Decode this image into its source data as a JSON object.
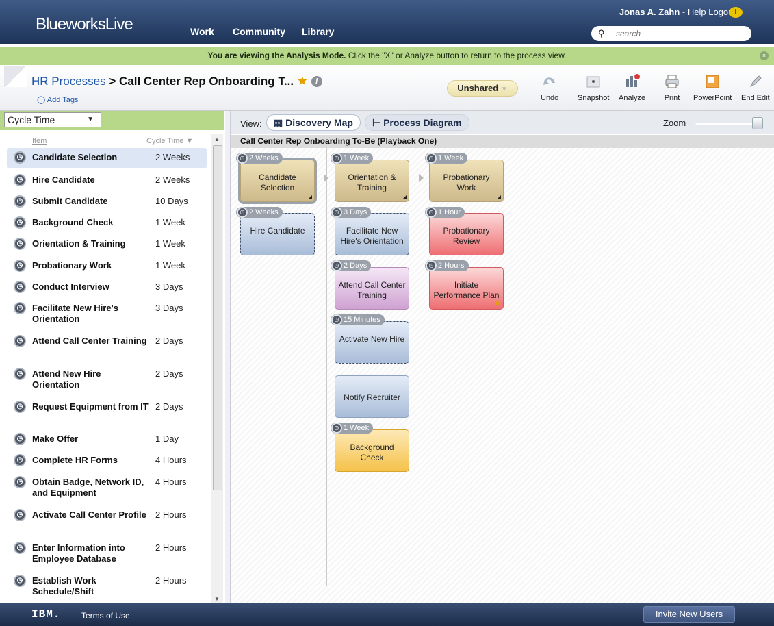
{
  "header": {
    "logo_bold": "Blueworks",
    "logo_thin": "Live",
    "nav": [
      "Work",
      "Community",
      "Library"
    ],
    "user": "Jonas A. Zahn",
    "sep": "-",
    "help": "Help",
    "logout": "Logout",
    "search_placeholder": "search"
  },
  "banner": {
    "bold": "You are viewing the Analysis Mode.",
    "rest": " Click the \"X\" or Analyze button to return to the process view."
  },
  "titlebar": {
    "crumb_link": "HR Processes",
    "crumb_sep": " > ",
    "crumb_current": "Call Center Rep Onboarding T...",
    "add_tags": "Add Tags",
    "share": "Unshared",
    "tools": [
      "Undo",
      "Snapshot",
      "Analyze",
      "Print",
      "PowerPoint",
      "End Edit"
    ]
  },
  "leftpanel": {
    "metric": "Cycle Time",
    "col_item": "Item",
    "col_time": "Cycle Time",
    "rows": [
      {
        "name": "Candidate Selection",
        "time": "2 Weeks"
      },
      {
        "name": "Hire Candidate",
        "time": "2 Weeks"
      },
      {
        "name": "Submit Candidate",
        "time": "10 Days"
      },
      {
        "name": "Background Check",
        "time": "1 Week"
      },
      {
        "name": "Orientation & Training",
        "time": "1 Week"
      },
      {
        "name": "Probationary Work",
        "time": "1 Week"
      },
      {
        "name": "Conduct Interview",
        "time": "3 Days"
      },
      {
        "name": "Facilitate New Hire's Orientation",
        "time": "3 Days"
      },
      {
        "name": "Attend Call Center Training",
        "time": "2 Days"
      },
      {
        "name": "Attend New Hire Orientation",
        "time": "2 Days"
      },
      {
        "name": "Request Equipment from IT",
        "time": "2 Days"
      },
      {
        "name": "Make Offer",
        "time": "1 Day"
      },
      {
        "name": "Complete HR Forms",
        "time": "4 Hours"
      },
      {
        "name": "Obtain Badge, Network ID, and Equipment",
        "time": "4 Hours"
      },
      {
        "name": "Activate Call Center Profile",
        "time": "2 Hours"
      },
      {
        "name": "Enter Information into Employee Database",
        "time": "2 Hours"
      },
      {
        "name": "Establish Work Schedule/Shift",
        "time": "2 Hours"
      }
    ]
  },
  "view": {
    "label": "View:",
    "discovery": "Discovery Map",
    "process": "Process Diagram",
    "zoom": "Zoom"
  },
  "canvas": {
    "title": "Call Center Rep Onboarding To-Be (Playback One)",
    "cards": {
      "c1": {
        "label": "Candidate Selection",
        "badge": "2 Weeks"
      },
      "c2": {
        "label": "Hire Candidate",
        "badge": "2 Weeks"
      },
      "c3": {
        "label": "Orientation & Training",
        "badge": "1 Week"
      },
      "c4": {
        "label": "Facilitate New Hire's Orientation",
        "badge": "3 Days"
      },
      "c5": {
        "label": "Attend Call Center Training",
        "badge": "2 Days"
      },
      "c6": {
        "label": "Activate New Hire",
        "badge": "15 Minutes"
      },
      "c7": {
        "label": "Notify Recruiter",
        "badge": ""
      },
      "c8": {
        "label": "Background Check",
        "badge": "1 Week"
      },
      "c9": {
        "label": "Probationary Work",
        "badge": "1 Week"
      },
      "c10": {
        "label": "Probationary Review",
        "badge": "1 Hour"
      },
      "c11": {
        "label": "Initiate Performance Plan",
        "badge": "2 Hours"
      }
    }
  },
  "footer": {
    "ibm": "IBM.",
    "terms": "Terms of Use",
    "invite": "Invite New Users"
  }
}
